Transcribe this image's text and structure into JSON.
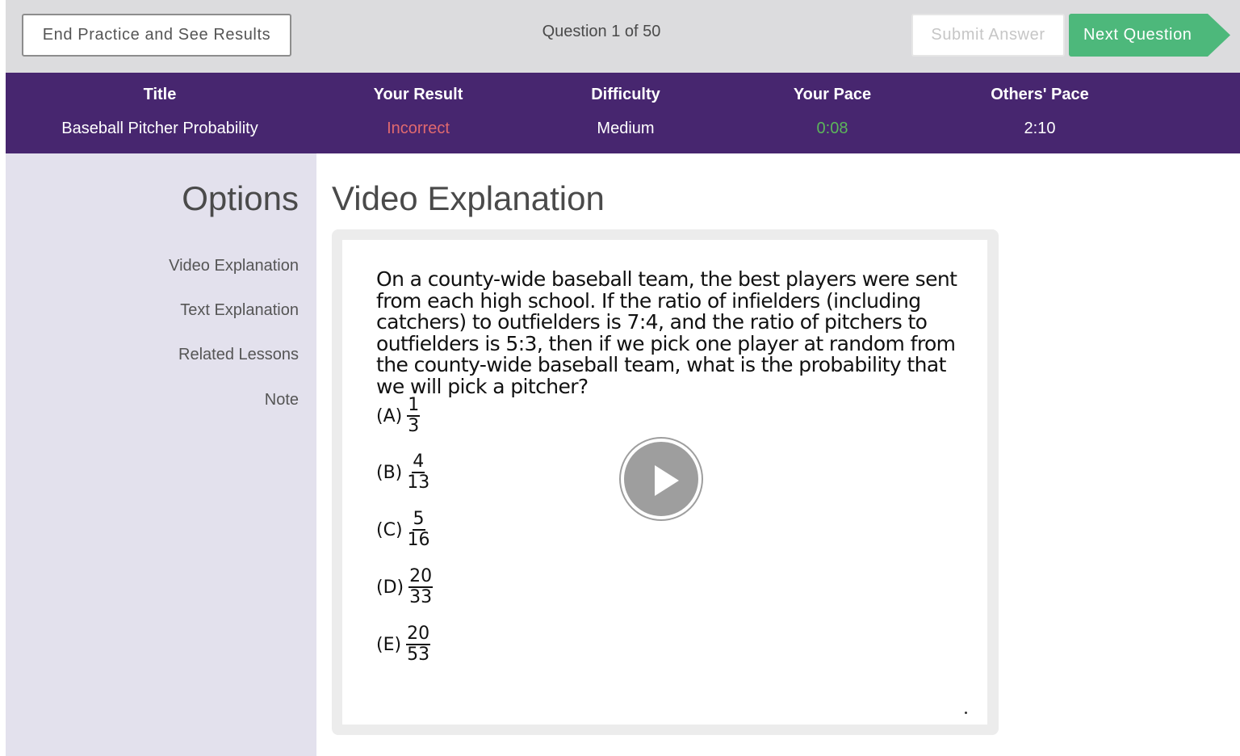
{
  "topbar": {
    "end_button": "End Practice and See Results",
    "counter": "Question 1 of 50",
    "submit_button": "Submit Answer",
    "next_button": "Next Question"
  },
  "info": {
    "title_label": "Title",
    "title_value": "Baseball Pitcher Probability",
    "result_label": "Your Result",
    "result_value": "Incorrect",
    "difficulty_label": "Difficulty",
    "difficulty_value": "Medium",
    "pace_label": "Your Pace",
    "pace_value": "0:08",
    "others_label": "Others' Pace",
    "others_value": "2:10"
  },
  "sidebar": {
    "title": "Options",
    "items": [
      {
        "label": "Video Explanation"
      },
      {
        "label": "Text Explanation"
      },
      {
        "label": "Related Lessons"
      },
      {
        "label": "Note"
      }
    ]
  },
  "main": {
    "title": "Video Explanation",
    "question": "On a county-wide baseball team, the best players were sent from each high school.  If the ratio of infielders (including catchers) to outfielders is 7:4, and the ratio of pitchers to outfielders is 5:3, then if we pick one player at random from the county-wide baseball team, what is the probability that we will pick a pitcher?",
    "choices": [
      {
        "letter": "(A)",
        "num": "1",
        "den": "3"
      },
      {
        "letter": "(B)",
        "num": "4",
        "den": "13"
      },
      {
        "letter": "(C)",
        "num": "5",
        "den": "16"
      },
      {
        "letter": "(D)",
        "num": "20",
        "den": "33"
      },
      {
        "letter": "(E)",
        "num": "20",
        "den": "53"
      }
    ]
  },
  "colors": {
    "accent_purple": "#47266f",
    "next_green": "#4db87b",
    "incorrect_red": "#e0696f",
    "pace_green": "#5cb65a"
  },
  "icons": {
    "play": "play-icon"
  }
}
